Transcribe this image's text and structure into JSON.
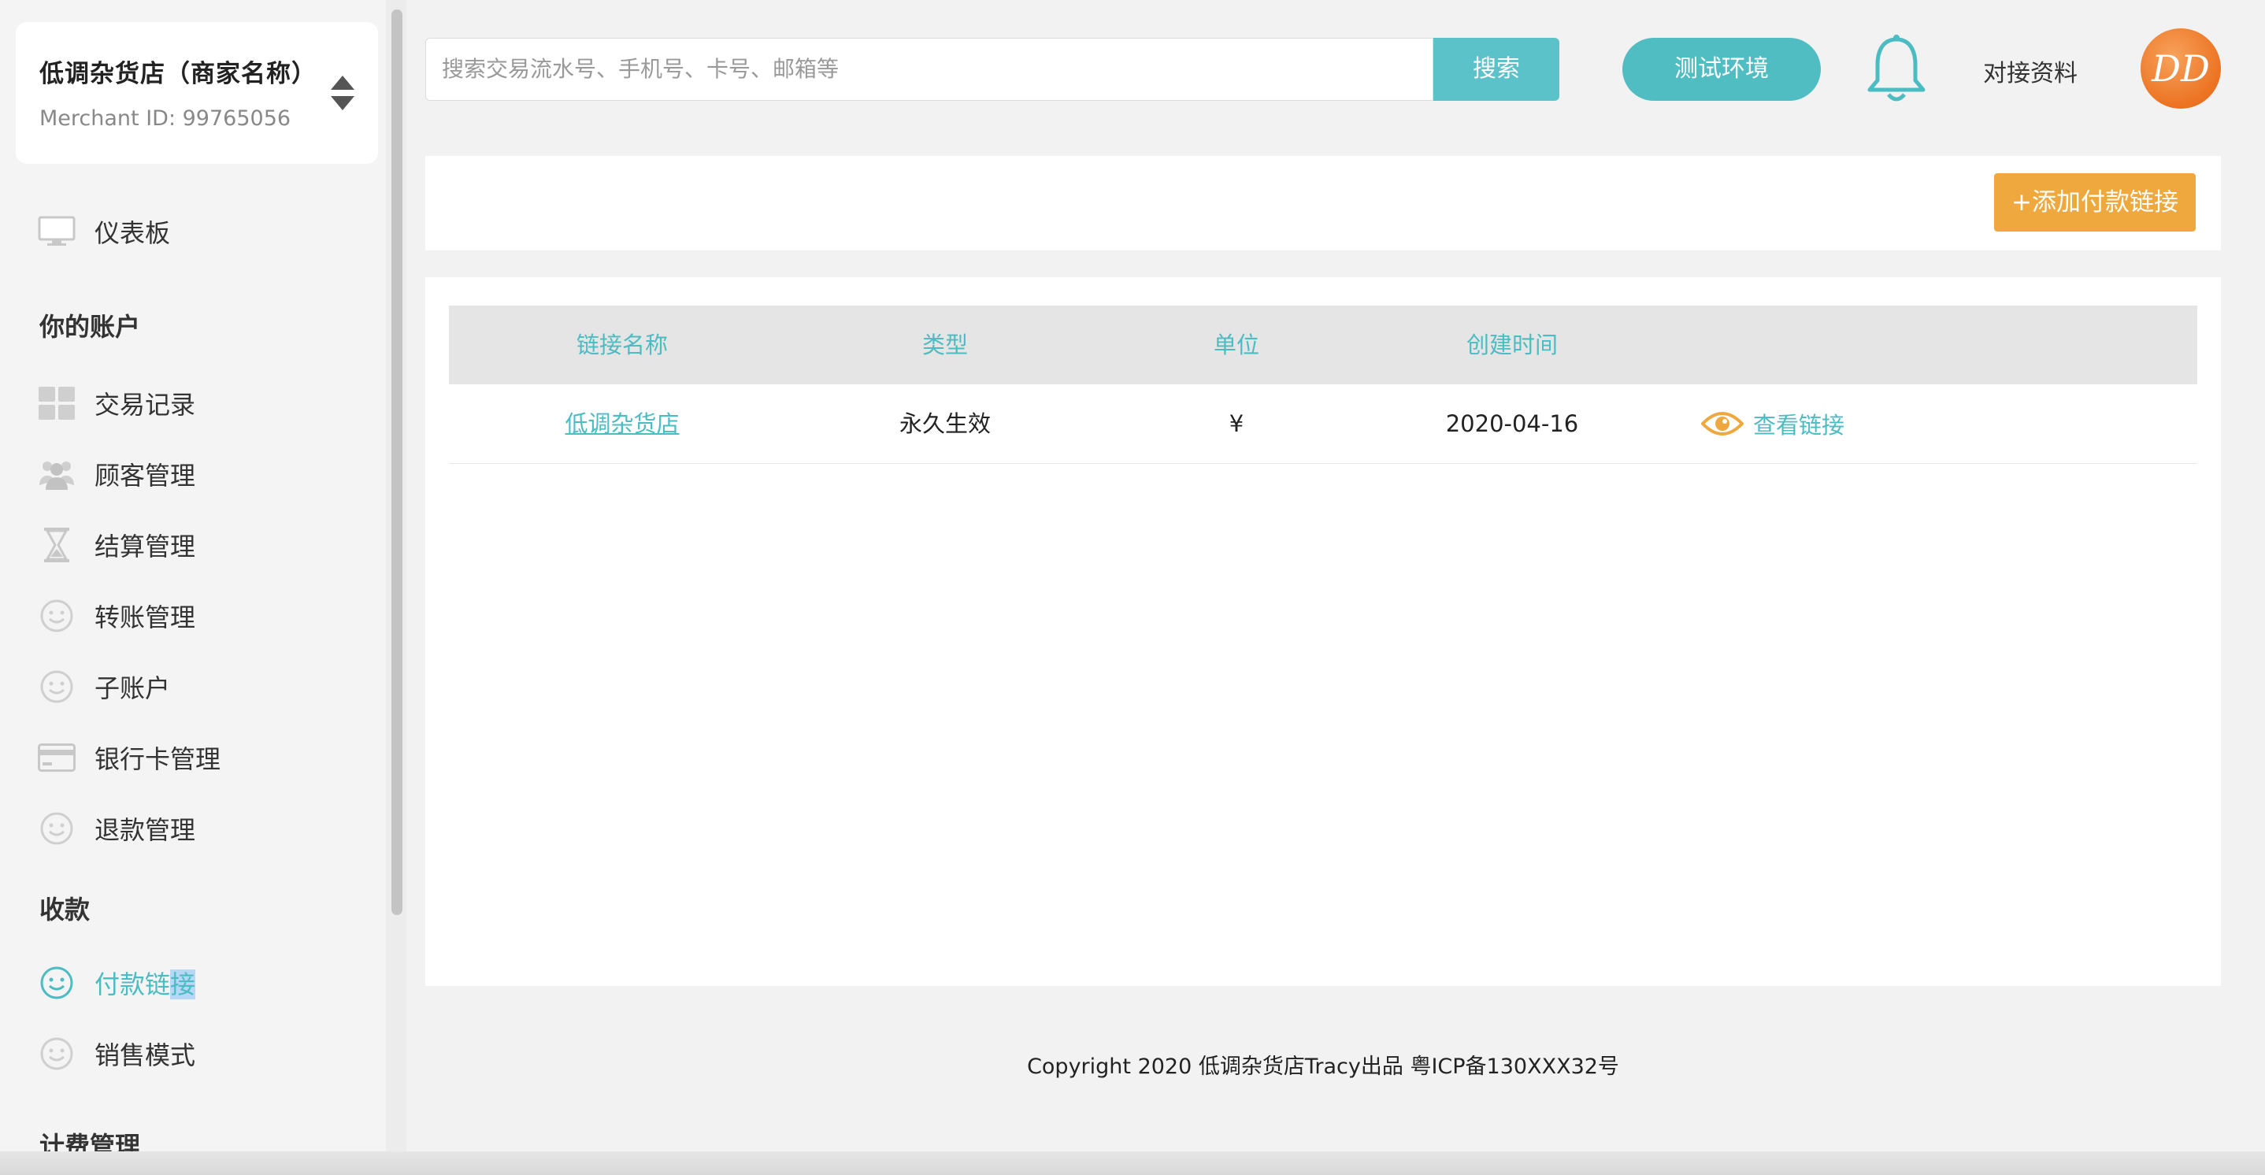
{
  "merchant": {
    "name": "低调杂货店（商家名称）",
    "id_label": "Merchant ID: 99765056"
  },
  "sidebar": {
    "dashboard": {
      "label": "仪表板",
      "icon": "monitor-icon"
    },
    "section_account": "你的账户",
    "account_items": [
      {
        "label": "交易记录",
        "icon": "grid-icon"
      },
      {
        "label": "顾客管理",
        "icon": "users-icon"
      },
      {
        "label": "结算管理",
        "icon": "hourglass-icon"
      },
      {
        "label": "转账管理",
        "icon": "smiley-icon"
      },
      {
        "label": "子账户",
        "icon": "smiley-icon"
      },
      {
        "label": "银行卡管理",
        "icon": "credit-card-icon"
      },
      {
        "label": "退款管理",
        "icon": "smiley-icon"
      }
    ],
    "section_collect": "收款",
    "collect_items": [
      {
        "label_plain": "付款链",
        "label_selected": "接",
        "icon": "smiley-icon",
        "active": true
      },
      {
        "label": "销售模式",
        "icon": "smiley-icon"
      }
    ],
    "section_billing": "计费管理"
  },
  "header": {
    "search_placeholder": "搜索交易流水号、手机号、卡号、邮箱等",
    "search_button": "搜索",
    "env_button": "测试环境",
    "docs_link": "对接资料",
    "avatar_text": "DD"
  },
  "toolbar": {
    "add_button": "+添加付款链接"
  },
  "table": {
    "columns": [
      "链接名称",
      "类型",
      "单位",
      "创建时间"
    ],
    "rows": [
      {
        "name": "低调杂货店",
        "type": "永久生效",
        "unit": "¥",
        "created": "2020-04-16",
        "action": "查看链接"
      }
    ]
  },
  "footer": {
    "text": "Copyright  2020 低调杂货店Tracy出品  粤ICP备130XXX32号"
  },
  "colors": {
    "accent": "#4cbcc3",
    "orange": "#efa83d",
    "avatar": "#ec7322"
  }
}
